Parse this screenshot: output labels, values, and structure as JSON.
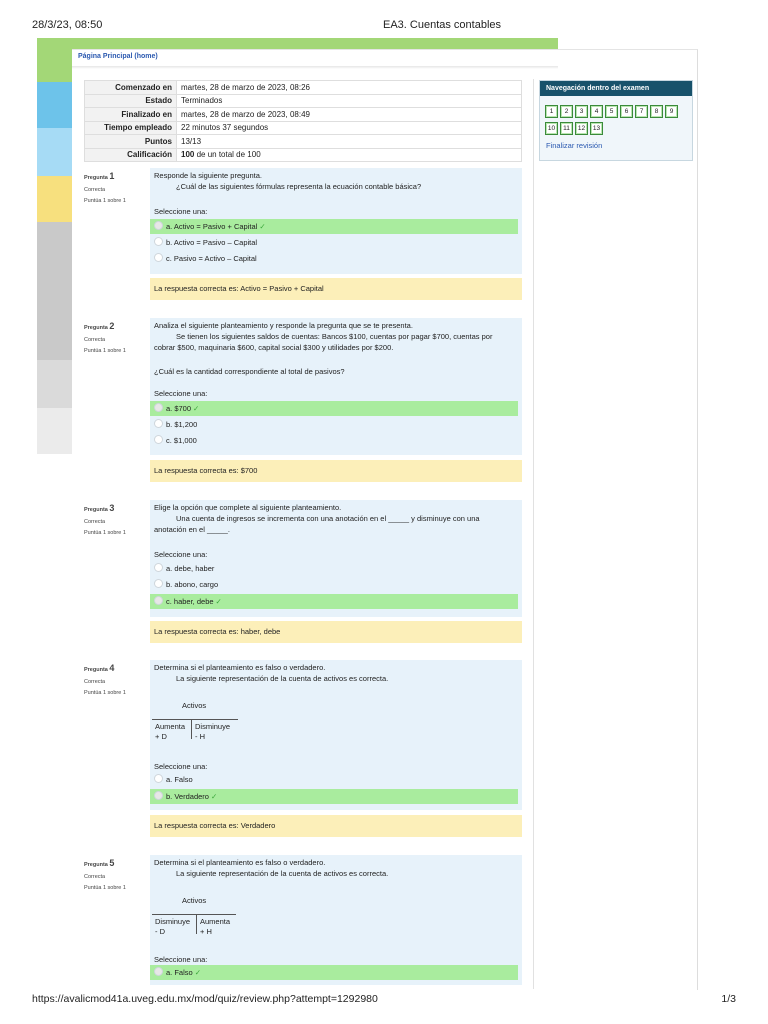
{
  "print_header": {
    "datetime": "28/3/23, 08:50",
    "title": "EA3. Cuentas contables"
  },
  "print_footer": {
    "url": "https://avalicmod41a.uveg.edu.mx/mod/quiz/review.php?attempt=1292980",
    "page": "1/3"
  },
  "breadcrumb": "Página Principal (home)",
  "summary": [
    {
      "label": "Comenzado en",
      "value": "martes, 28 de marzo de 2023, 08:26"
    },
    {
      "label": "Estado",
      "value": "Terminados"
    },
    {
      "label": "Finalizado en",
      "value": "martes, 28 de marzo de 2023, 08:49"
    },
    {
      "label": "Tiempo empleado",
      "value": "22 minutos 37 segundos"
    },
    {
      "label": "Puntos",
      "value": "13/13"
    },
    {
      "label": "Calificación",
      "value_bold": "100",
      "value_rest": " de un total de 100"
    }
  ],
  "common": {
    "q_prefix": "Pregunta",
    "state": "Correcta",
    "points": "Puntúa 1 sobre 1",
    "select_prompt": "Seleccione una:",
    "check": "✓"
  },
  "questions": [
    {
      "number": "1",
      "intro": "Responde la siguiente pregunta.",
      "text": "¿Cuál de las siguientes fórmulas representa la ecuación contable básica?",
      "options": [
        "a. Activo = Pasivo + Capital",
        "b. Activo = Pasivo – Capital",
        "c. Pasivo = Activo – Capital"
      ],
      "feedback": "La respuesta correcta es: Activo = Pasivo + Capital"
    },
    {
      "number": "2",
      "intro": "Analiza el siguiente planteamiento y responde la pregunta que se te presenta.",
      "text": "Se tienen los siguientes saldos de cuentas: Bancos $100, cuentas por pagar $700, cuentas por",
      "text2": "cobrar $500, maquinaria $600, capital social $300 y utilidades por $200.",
      "question": "¿Cuál es la cantidad correspondiente al total de pasivos?",
      "options": [
        "a. $700",
        "b. $1,200",
        "c. $1,000"
      ],
      "feedback": "La respuesta correcta es: $700"
    },
    {
      "number": "3",
      "intro": "Elige la opción que complete al siguiente planteamiento.",
      "text": "Una cuenta de ingresos se incrementa con una anotación en el _____ y disminuye con una",
      "text2": "anotación en el _____.",
      "options": [
        "a. debe, haber",
        "b. abono, cargo",
        "c. haber, debe"
      ],
      "feedback": "La respuesta correcta es: haber, debe"
    },
    {
      "number": "4",
      "intro": "Determina si el planteamiento es falso o verdadero.",
      "text": "La siguiente representación de la cuenta de activos es correcta.",
      "t_title": "Activos",
      "t_left": [
        "Aumenta",
        "+ D"
      ],
      "t_right": [
        "Disminuye",
        "- H"
      ],
      "options": [
        "a. Falso",
        "b. Verdadero"
      ],
      "feedback": "La respuesta correcta es: Verdadero"
    },
    {
      "number": "5",
      "intro": "Determina si el planteamiento es falso o verdadero.",
      "text": "La siguiente representación de la cuenta de activos es correcta.",
      "t_title": "Activos",
      "t_left": [
        "Disminuye",
        "- D"
      ],
      "t_right": [
        "Aumenta",
        "+ H"
      ],
      "options": [
        "a. Falso"
      ]
    }
  ],
  "nav": {
    "title": "Navegación dentro del examen",
    "buttons": [
      "1",
      "2",
      "3",
      "4",
      "5",
      "6",
      "7",
      "8",
      "9",
      "10",
      "11",
      "12",
      "13"
    ],
    "finish": "Finalizar revisión"
  },
  "colors": {
    "correct_option": "#a9ec9e",
    "feedback_bg": "#fcefb9",
    "question_bg": "#e7f2fa",
    "nav_header": "#18526b"
  },
  "icons": {
    "correct": "check-icon",
    "radio": "radio-icon"
  }
}
